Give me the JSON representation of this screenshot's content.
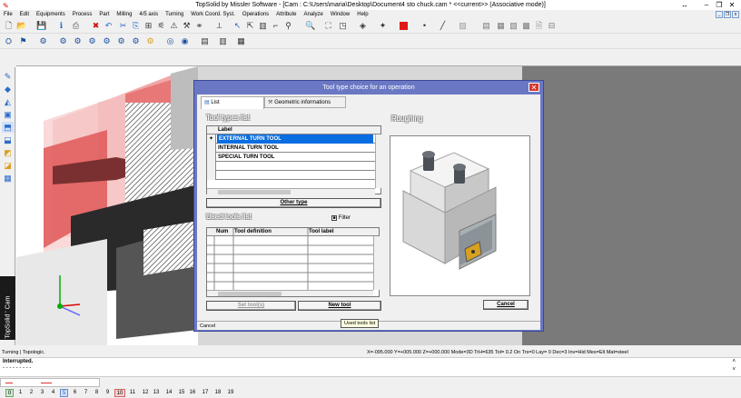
{
  "window": {
    "title": "TopSolid by Missler Software - [Cam : C:\\Users\\maria\\Desktop\\Document4 sto chuck.cam * <<current>> (Associative mode)]"
  },
  "menu": [
    "File",
    "Edit",
    "Equipments",
    "Process",
    "Part",
    "Milling",
    "4/5 axis",
    "Turning",
    "Work Coord. Syst.",
    "Operations",
    "Attribute",
    "Analyze",
    "Window",
    "Help"
  ],
  "sidebar": {
    "label": "TopSolid ' Cam"
  },
  "dialog": {
    "title": "Tool type choice for an operation",
    "tabs": [
      "List",
      "Geometric informations"
    ],
    "tool_types_title": "Tool types list",
    "preview_title": "Roughing",
    "tool_types": {
      "header": "Label",
      "rows": [
        "EXTERNAL TURN TOOL",
        "INTERNAL TURN TOOL",
        "SPECIAL TURN TOOL"
      ],
      "selected_marker": "✦"
    },
    "other_type_label": "Other type",
    "used_tools_title": "Used tools list",
    "filter_label": "Filter",
    "used_tools": {
      "headers": [
        "Num",
        "Tool definition",
        "Tool label"
      ]
    },
    "set_tool_label": "Set tool(s)",
    "new_tool_label": "New tool",
    "cancel_label": "Cancel",
    "status": "Cancel"
  },
  "tooltip": "Used tools list",
  "status_bar": {
    "left": "Turning | Topologic.",
    "coords": "X=-095.000  Y=+005.000  Z=+000.000  Mode=3D  TrH=635  Tol=  0.2  On  Trs=0  Lay=  0  Dec=3  Inv=Hid  Mes=Elt  Mat=steel"
  },
  "command": {
    "message": "Interrupted.",
    "dashes": "- - - - - - - - -"
  },
  "pages": [
    "0",
    "1",
    "2",
    "3",
    "4",
    "5",
    "6",
    "7",
    "8",
    "9",
    "10",
    "11",
    "12",
    "13",
    "14",
    "15",
    "16",
    "17",
    "18",
    "19"
  ],
  "colors": {
    "dialog_frame": "#6a78c4",
    "selection": "#0a6de0",
    "part_red": "#e87878"
  }
}
